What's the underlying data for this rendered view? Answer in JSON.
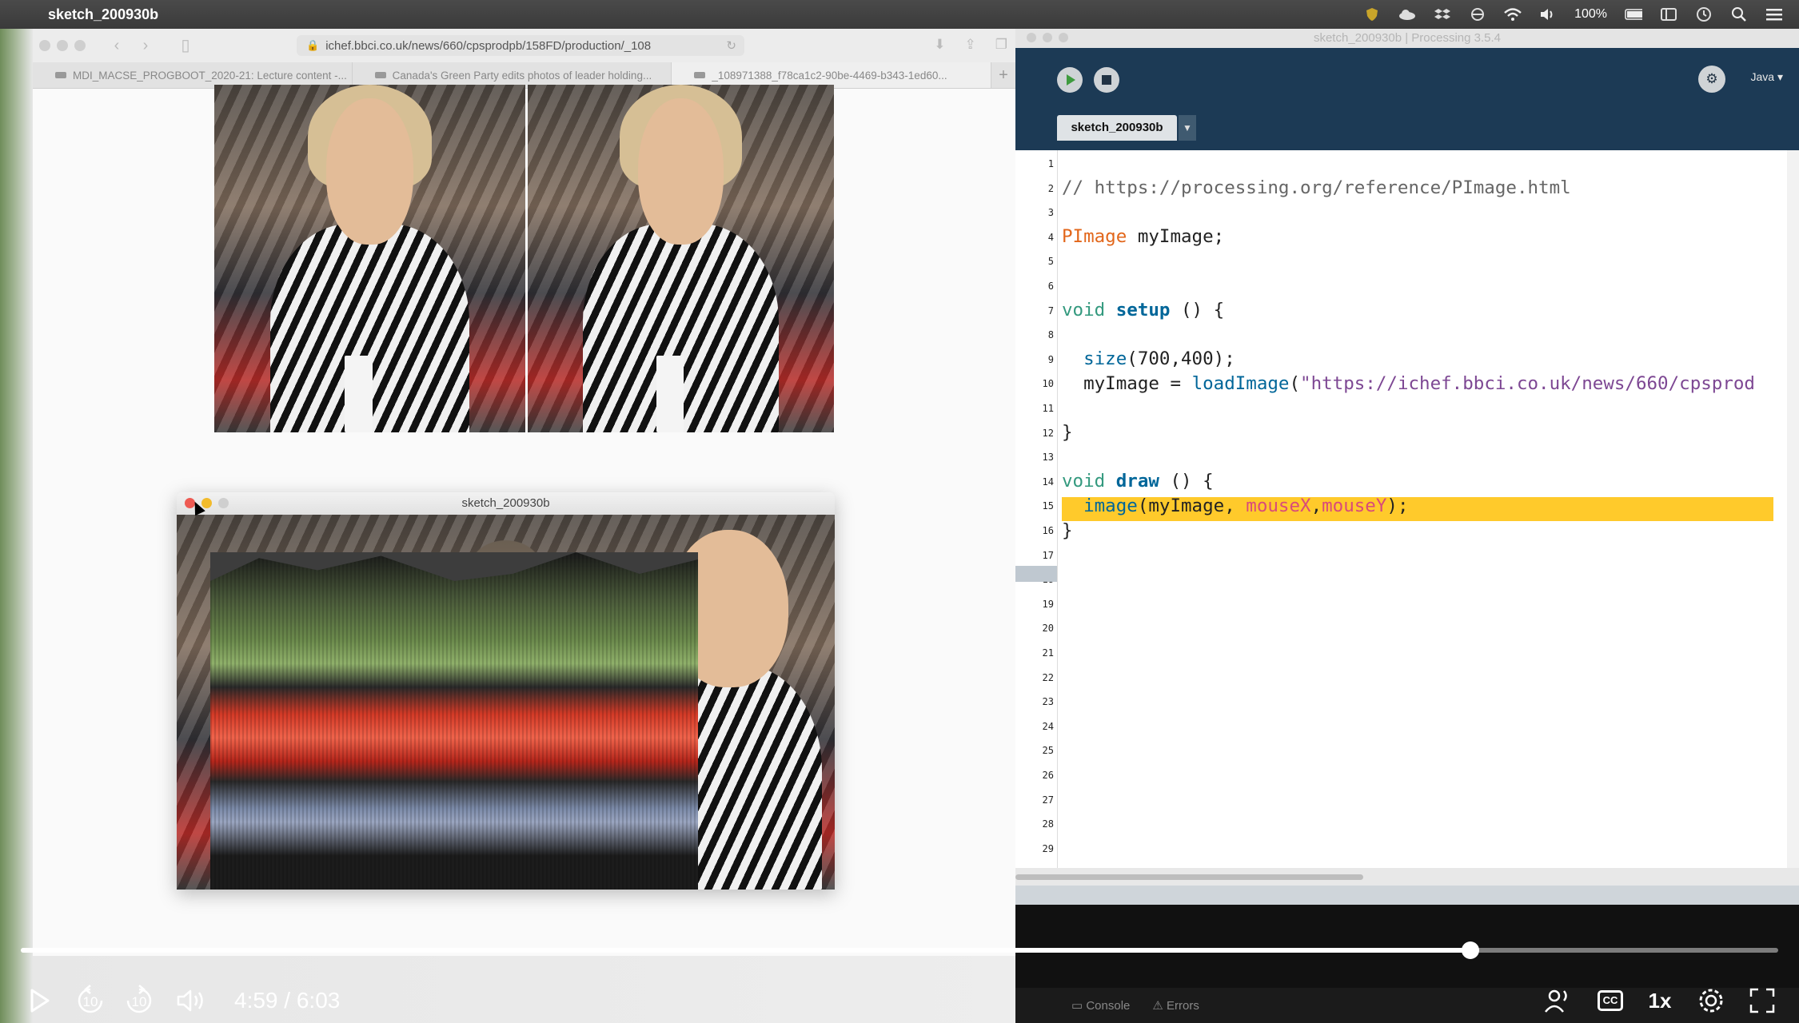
{
  "menubar": {
    "app_name": "sketch_200930b",
    "battery": "100%"
  },
  "browser": {
    "url": "ichef.bbci.co.uk/news/660/cpsprodpb/158FD/production/_108",
    "tabs": [
      {
        "label": "MDI_MACSE_PROGBOOT_2020-21: Lecture content -..."
      },
      {
        "label": "Canada's Green Party edits photos of leader holding..."
      },
      {
        "label": "_108971388_f78ca1c2-90be-4469-b343-1ed60..."
      }
    ]
  },
  "sketch_window": {
    "title": "sketch_200930b"
  },
  "ide": {
    "window_title": "sketch_200930b | Processing 3.5.4",
    "mode": "Java ▾",
    "tab_name": "sketch_200930b",
    "line_numbers": [
      "1",
      "2",
      "3",
      "4",
      "5",
      "6",
      "7",
      "8",
      "9",
      "10",
      "11",
      "12",
      "13",
      "14",
      "15",
      "16",
      "17",
      "18",
      "19",
      "20",
      "21",
      "22",
      "23",
      "24",
      "25",
      "26",
      "27",
      "28",
      "29"
    ],
    "code": {
      "l2": "// https://processing.org/reference/PImage.html",
      "l4_type": "PImage",
      "l4_rest": " myImage;",
      "l7_void": "void",
      "l7_fn": "setup",
      "l7_rest": " () {",
      "l9_fn": "size",
      "l9_rest": "(700,400);",
      "l10_pre": "myImage = ",
      "l10_fn": "loadImage",
      "l10_paren": "(",
      "l10_str": "\"https://ichef.bbci.co.uk/news/660/cpsprod",
      "l12": "}",
      "l14_void": "void",
      "l14_fn": "draw",
      "l14_rest": " () {",
      "l15_fn": "image",
      "l15_mid": "(myImage, ",
      "l15_var1": "mouseX",
      "l15_comma": ",",
      "l15_var2": "mouseY",
      "l15_end": ");",
      "l16": "}"
    },
    "console_tabs": [
      "Console",
      "Errors"
    ]
  },
  "player": {
    "current_time": "4:59",
    "separator": " / ",
    "duration": "6:03",
    "progress": 0.8248,
    "skip_back": "10",
    "skip_forward": "10",
    "speed": "1x",
    "cc": "CC"
  }
}
